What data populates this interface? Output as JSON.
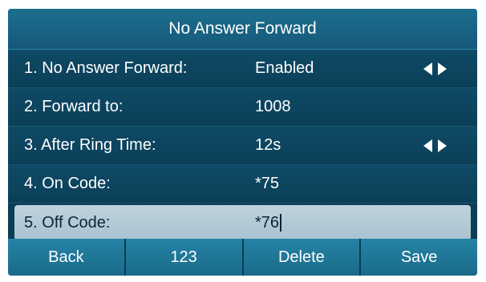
{
  "title": "No Answer Forward",
  "rows": [
    {
      "label": "1. No Answer Forward:",
      "value": "Enabled",
      "has_arrows": true
    },
    {
      "label": "2. Forward to:",
      "value": "1008",
      "has_arrows": false
    },
    {
      "label": "3. After Ring Time:",
      "value": "12s",
      "has_arrows": true
    },
    {
      "label": "4. On Code:",
      "value": "*75",
      "has_arrows": false
    },
    {
      "label": "5. Off Code:",
      "value": "*76",
      "has_arrows": false,
      "selected": true
    }
  ],
  "softkeys": [
    "Back",
    "123",
    "Delete",
    "Save"
  ],
  "colors": {
    "background": "#0b3d55",
    "title_bar": "#15587a",
    "selected_row": "#b3c9d4",
    "softkey": "#2583a5"
  }
}
